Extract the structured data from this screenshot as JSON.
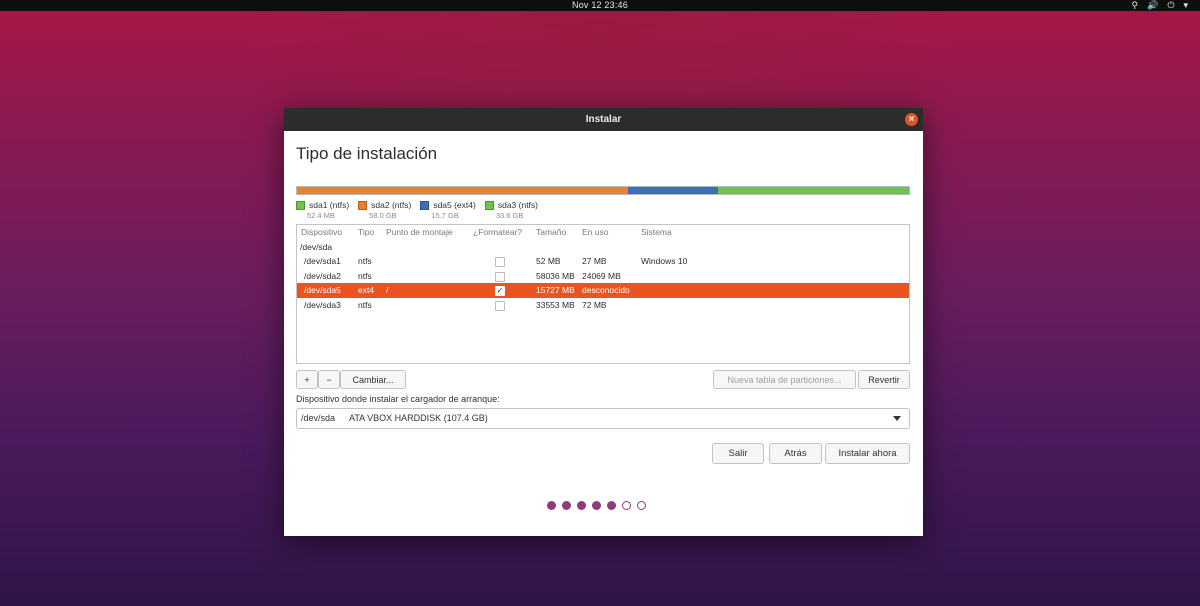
{
  "topbar": {
    "clock": "Nov 12  23:46",
    "icons": [
      "network-icon",
      "volume-icon",
      "power-icon",
      "chevron-down-icon"
    ]
  },
  "window": {
    "title": "Instalar",
    "heading": "Tipo de instalación",
    "partition_bar": [
      {
        "name": "sda1",
        "color": "#6fc24a",
        "fraction": 0.0005
      },
      {
        "name": "sda2",
        "color": "#e8812f",
        "fraction": 0.5408
      },
      {
        "name": "sda5",
        "color": "#3c6fb5",
        "fraction": 0.1466
      },
      {
        "name": "sda3",
        "color": "#6fc24a",
        "fraction": 0.3126
      }
    ],
    "legend": [
      {
        "label": "sda1 (ntfs)",
        "size": "52.4 MB",
        "color": "#6fc24a"
      },
      {
        "label": "sda2 (ntfs)",
        "size": "58.0 GB",
        "color": "#e8812f"
      },
      {
        "label": "sda5 (ext4)",
        "size": "15.7 GB",
        "color": "#3c6fb5"
      },
      {
        "label": "sda3 (ntfs)",
        "size": "33.6 GB",
        "color": "#6fc24a"
      }
    ],
    "table": {
      "headers": {
        "device": "Dispositivo",
        "type": "Tipo",
        "mount": "Punto de montaje",
        "format": "¿Formatear?",
        "size": "Tamaño",
        "used": "En uso",
        "system": "Sistema"
      },
      "group": "/dev/sda",
      "rows": [
        {
          "device": "/dev/sda1",
          "type": "ntfs",
          "mount": "",
          "format": false,
          "size": "52 MB",
          "used": "27 MB",
          "system": "Windows 10",
          "selected": false
        },
        {
          "device": "/dev/sda2",
          "type": "ntfs",
          "mount": "",
          "format": false,
          "size": "58036 MB",
          "used": "24069 MB",
          "system": "",
          "selected": false
        },
        {
          "device": "/dev/sda5",
          "type": "ext4",
          "mount": "/",
          "format": true,
          "size": "15727 MB",
          "used": "desconocido",
          "system": "",
          "selected": true
        },
        {
          "device": "/dev/sda3",
          "type": "ntfs",
          "mount": "",
          "format": false,
          "size": "33553 MB",
          "used": "72 MB",
          "system": "",
          "selected": false
        }
      ]
    },
    "toolbar": {
      "add": "+",
      "remove": "−",
      "change": "Cambiar...",
      "new_table": "Nueva tabla de particiones...",
      "revert": "Revertir"
    },
    "bootloader": {
      "label": "Dispositivo donde instalar el cargador de arranque:",
      "device": "/dev/sda",
      "description": "ATA VBOX HARDDISK (107.4 GB)"
    },
    "actions": {
      "quit": "Salir",
      "back": "Atrás",
      "install": "Instalar ahora"
    },
    "steps": {
      "total": 7,
      "completed": 5
    },
    "accent": "#e95420"
  }
}
